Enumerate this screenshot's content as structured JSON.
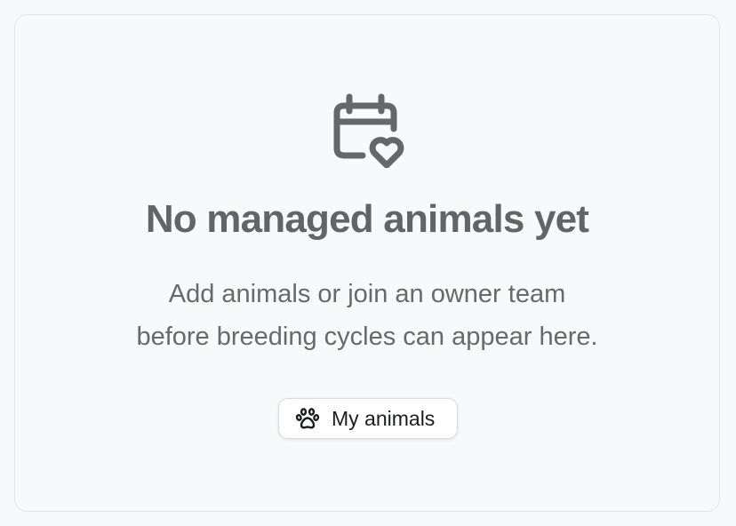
{
  "empty_state": {
    "icon": "calendar-heart-icon",
    "title": "No managed animals yet",
    "description_line1": "Add animals or join an owner team",
    "description_line2": "before breeding cycles can appear here.",
    "button": {
      "icon": "paw-icon",
      "label": "My animals"
    }
  },
  "colors": {
    "background": "#f8f9fb",
    "border": "#e3e5ea",
    "icon": "#666769",
    "title": "#636466",
    "text": "#68696b",
    "button_text": "#1b1c1e"
  }
}
